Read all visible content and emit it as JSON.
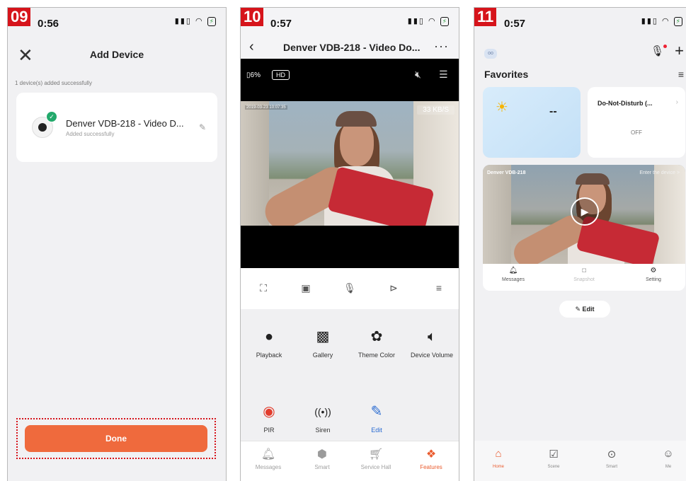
{
  "colors": {
    "accent": "#ea5b2e",
    "badge": "#d6141b",
    "success": "#22a96b"
  },
  "panel1": {
    "badge": "09",
    "time": "0:56",
    "title": "Add Device",
    "status": "1 device(s) added successfully",
    "device_name": "Denver VDB-218 - Video D...",
    "device_status": "Added successfully",
    "done_label": "Done"
  },
  "panel2": {
    "badge": "10",
    "time": "0:57",
    "title": "Denver VDB-218 - Video Do...",
    "battery": "6%",
    "quality": "HD",
    "timestamp": "2019-03-23 10:07:35",
    "speed": "33 KB/S",
    "features": [
      {
        "label": "Playback",
        "icon": "play-icon"
      },
      {
        "label": "Gallery",
        "icon": "gallery-icon"
      },
      {
        "label": "Theme Color",
        "icon": "palette-icon"
      },
      {
        "label": "Device Volume",
        "icon": "volume-icon"
      },
      {
        "label": "PIR",
        "icon": "pir-icon"
      },
      {
        "label": "Siren",
        "icon": "siren-icon"
      },
      {
        "label": "Edit",
        "icon": "edit-icon"
      }
    ],
    "tabs": [
      {
        "label": "Messages",
        "icon": "bell-icon"
      },
      {
        "label": "Smart",
        "icon": "smart-icon"
      },
      {
        "label": "Service Hall",
        "icon": "cart-icon"
      },
      {
        "label": "Features",
        "icon": "features-icon"
      }
    ]
  },
  "panel3": {
    "badge": "11",
    "time": "0:57",
    "favorites": "Favorites",
    "weather_value": "--",
    "dnd_title": "Do-Not-Disturb (...",
    "dnd_state": "OFF",
    "camera_name": "Denver VDB-218",
    "enter_device": "Enter the device >",
    "camera_actions": [
      {
        "label": "Messages",
        "icon": "bell-icon"
      },
      {
        "label": "Snapshot",
        "icon": "camera-icon"
      },
      {
        "label": "Setting",
        "icon": "gear-icon"
      }
    ],
    "edit_label": "Edit",
    "tabs": [
      {
        "label": "Home",
        "icon": "home-icon"
      },
      {
        "label": "Scene",
        "icon": "scene-icon"
      },
      {
        "label": "Smart",
        "icon": "smart-icon"
      },
      {
        "label": "Me",
        "icon": "profile-icon"
      }
    ]
  }
}
